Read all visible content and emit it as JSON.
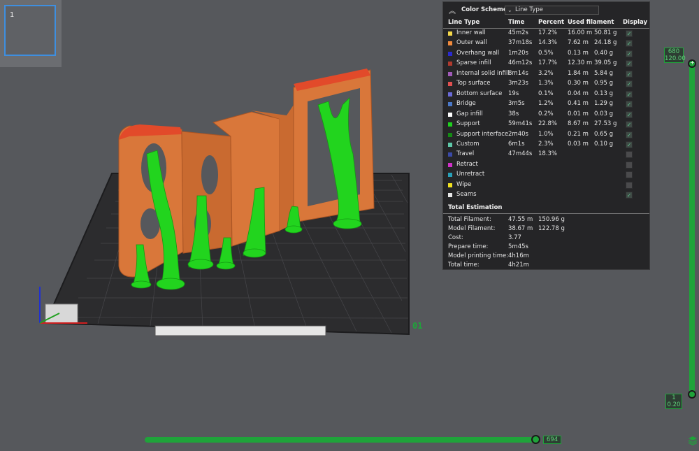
{
  "plate": {
    "number": "1"
  },
  "color_scheme": {
    "title": "Color Scheme",
    "selected": "Line Type",
    "columns": {
      "type": "Line Type",
      "time": "Time",
      "percent": "Percent",
      "filament": "Used filament",
      "display": "Display"
    },
    "rows": [
      {
        "name": "Inner wall",
        "color": "#f5d84a",
        "time": "45m2s",
        "percent": "17.2%",
        "length": "16.00 m",
        "weight": "50.81 g",
        "display": true
      },
      {
        "name": "Outer wall",
        "color": "#f08a3c",
        "time": "37m18s",
        "percent": "14.3%",
        "length": "7.62 m",
        "weight": "24.18 g",
        "display": true
      },
      {
        "name": "Overhang wall",
        "color": "#2a2ad0",
        "time": "1m20s",
        "percent": "0.5%",
        "length": "0.13 m",
        "weight": "0.40 g",
        "display": true
      },
      {
        "name": "Sparse infill",
        "color": "#b03a2e",
        "time": "46m12s",
        "percent": "17.7%",
        "length": "12.30 m",
        "weight": "39.05 g",
        "display": true
      },
      {
        "name": "Internal solid infill",
        "color": "#a05ab8",
        "time": "8m14s",
        "percent": "3.2%",
        "length": "1.84 m",
        "weight": "5.84 g",
        "display": true
      },
      {
        "name": "Top surface",
        "color": "#e05050",
        "time": "3m23s",
        "percent": "1.3%",
        "length": "0.30 m",
        "weight": "0.95 g",
        "display": true
      },
      {
        "name": "Bottom surface",
        "color": "#6a6ad8",
        "time": "19s",
        "percent": "0.1%",
        "length": "0.04 m",
        "weight": "0.13 g",
        "display": true
      },
      {
        "name": "Bridge",
        "color": "#4a78c8",
        "time": "3m5s",
        "percent": "1.2%",
        "length": "0.41 m",
        "weight": "1.29 g",
        "display": true
      },
      {
        "name": "Gap infill",
        "color": "#ffffff",
        "time": "38s",
        "percent": "0.2%",
        "length": "0.01 m",
        "weight": "0.03 g",
        "display": true
      },
      {
        "name": "Support",
        "color": "#1fd01f",
        "time": "59m41s",
        "percent": "22.8%",
        "length": "8.67 m",
        "weight": "27.53 g",
        "display": true
      },
      {
        "name": "Support interface",
        "color": "#148a14",
        "time": "2m40s",
        "percent": "1.0%",
        "length": "0.21 m",
        "weight": "0.65 g",
        "display": true
      },
      {
        "name": "Custom",
        "color": "#5ec8a8",
        "time": "6m1s",
        "percent": "2.3%",
        "length": "0.03 m",
        "weight": "0.10 g",
        "display": true
      },
      {
        "name": "Travel",
        "color": "#3a4aa8",
        "time": "47m44s",
        "percent": "18.3%",
        "length": "",
        "weight": "",
        "display": false
      },
      {
        "name": "Retract",
        "color": "#d030c8",
        "time": "",
        "percent": "",
        "length": "",
        "weight": "",
        "display": false
      },
      {
        "name": "Unretract",
        "color": "#28a0b8",
        "time": "",
        "percent": "",
        "length": "",
        "weight": "",
        "display": false
      },
      {
        "name": "Wipe",
        "color": "#f0e020",
        "time": "",
        "percent": "",
        "length": "",
        "weight": "",
        "display": false
      },
      {
        "name": "Seams",
        "color": "#e8e8e8",
        "time": "",
        "percent": "",
        "length": "",
        "weight": "",
        "display": true
      }
    ],
    "total_title": "Total Estimation",
    "totals": [
      {
        "label": "Total Filament:",
        "value": "47.55 m",
        "extra": "150.96 g"
      },
      {
        "label": "Model Filament:",
        "value": "38.67 m",
        "extra": "122.78 g"
      },
      {
        "label": "Cost:",
        "value": "3.77",
        "extra": ""
      },
      {
        "label": "Prepare time:",
        "value": "5m45s",
        "extra": ""
      },
      {
        "label": "Model printing time:",
        "value": "4h16m",
        "extra": ""
      },
      {
        "label": "Total time:",
        "value": "4h21m",
        "extra": ""
      }
    ]
  },
  "layer_slider": {
    "top_layer": "680",
    "top_height": "120.00",
    "bottom_layer": "1",
    "bottom_height": "0.20"
  },
  "move_slider": {
    "value": "694"
  },
  "plate_label": "01",
  "colors": {
    "accent": "#1fa33a",
    "model": "#d9773a",
    "support": "#22d41e",
    "bed": "#2c2c2e"
  }
}
